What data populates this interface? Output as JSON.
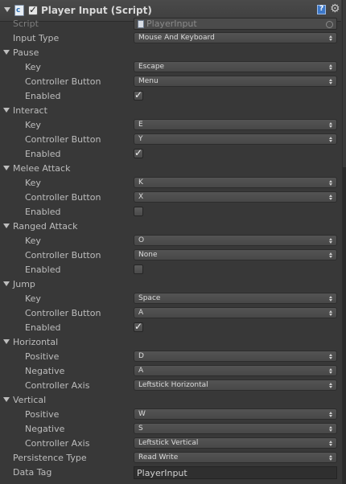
{
  "header": {
    "title": "Player Input (Script)",
    "enabled": true
  },
  "fields": {
    "script": {
      "label": "Script",
      "value": "PlayerInput"
    },
    "input_type": {
      "label": "Input Type",
      "value": "Mouse And Keyboard"
    },
    "persistence_type": {
      "label": "Persistence Type",
      "value": "Read Write"
    },
    "data_tag": {
      "label": "Data Tag",
      "value": "PlayerInput"
    }
  },
  "groups": {
    "pause": {
      "label": "Pause",
      "key_label": "Key",
      "key": "Escape",
      "button_label": "Controller Button",
      "button": "Menu",
      "enabled_label": "Enabled",
      "enabled": true
    },
    "interact": {
      "label": "Interact",
      "key_label": "Key",
      "key": "E",
      "button_label": "Controller Button",
      "button": "Y",
      "enabled_label": "Enabled",
      "enabled": true
    },
    "melee": {
      "label": "Melee Attack",
      "key_label": "Key",
      "key": "K",
      "button_label": "Controller Button",
      "button": "X",
      "enabled_label": "Enabled",
      "enabled": false
    },
    "ranged": {
      "label": "Ranged Attack",
      "key_label": "Key",
      "key": "O",
      "button_label": "Controller Button",
      "button": "None",
      "enabled_label": "Enabled",
      "enabled": false
    },
    "jump": {
      "label": "Jump",
      "key_label": "Key",
      "key": "Space",
      "button_label": "Controller Button",
      "button": "A",
      "enabled_label": "Enabled",
      "enabled": true
    },
    "horizontal": {
      "label": "Horizontal",
      "positive_label": "Positive",
      "positive": "D",
      "negative_label": "Negative",
      "negative": "A",
      "axis_label": "Controller Axis",
      "axis": "Leftstick Horizontal"
    },
    "vertical": {
      "label": "Vertical",
      "positive_label": "Positive",
      "positive": "W",
      "negative_label": "Negative",
      "negative": "S",
      "axis_label": "Controller Axis",
      "axis": "Leftstick Vertical"
    }
  }
}
